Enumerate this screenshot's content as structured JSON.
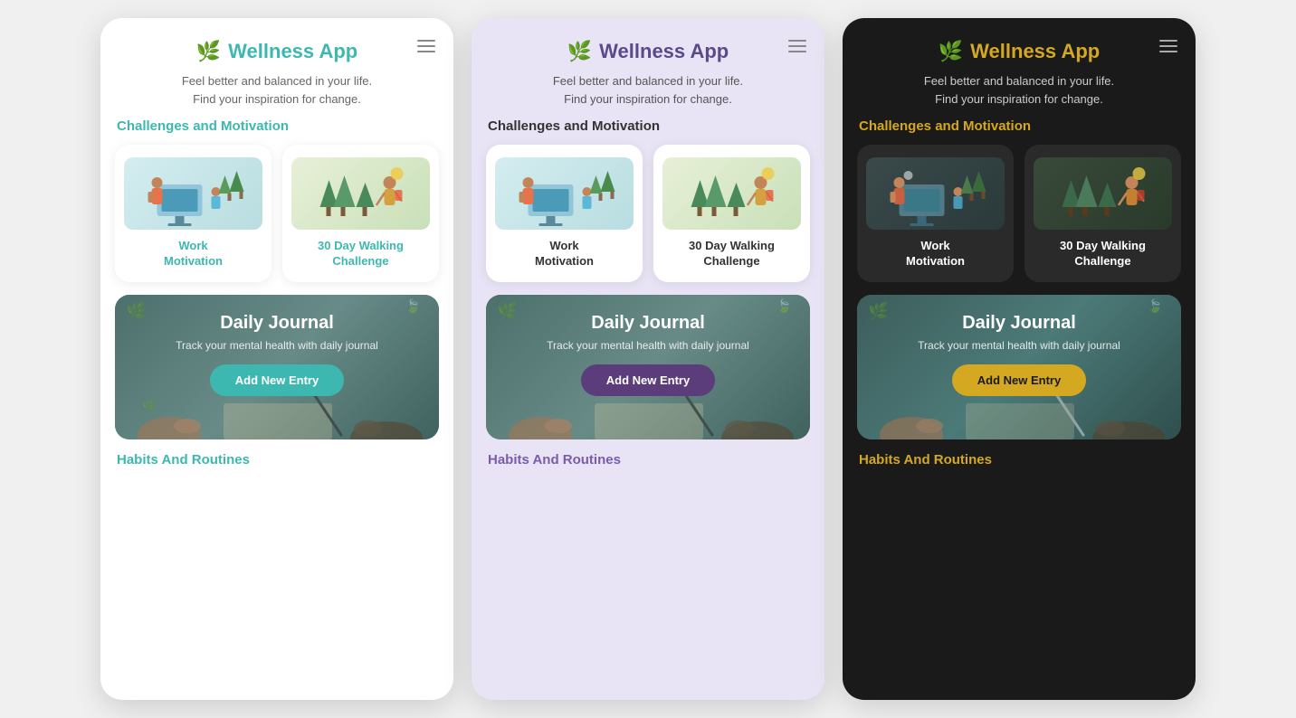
{
  "themes": [
    "light",
    "purple",
    "dark"
  ],
  "app": {
    "title": "Wellness App",
    "subtitle_line1": "Feel better and balanced in your life.",
    "subtitle_line2": "Find your inspiration for change.",
    "hamburger_label": "Menu"
  },
  "sections": {
    "challenges": {
      "title": "Challenges and Motivation",
      "cards": [
        {
          "id": "work-motivation",
          "title": "Work\nMotivation",
          "illustration": "work"
        },
        {
          "id": "walking-challenge",
          "title": "30 Day Walking\nChallenge",
          "illustration": "walking"
        }
      ]
    },
    "journal": {
      "title": "Daily Journal",
      "subtitle": "Track your mental health with daily journal",
      "button_label": "Add New Entry"
    },
    "habits": {
      "title": "Habits And Routines"
    }
  },
  "colors": {
    "light": {
      "accent": "#3db8b0",
      "bg": "#ffffff",
      "btn": "#3db8b0"
    },
    "purple": {
      "accent": "#5a4a8a",
      "bg": "#e8e4f5",
      "btn": "#5a3d7a"
    },
    "dark": {
      "accent": "#d4a820",
      "bg": "#1a1a1a",
      "btn": "#d4a820"
    }
  }
}
